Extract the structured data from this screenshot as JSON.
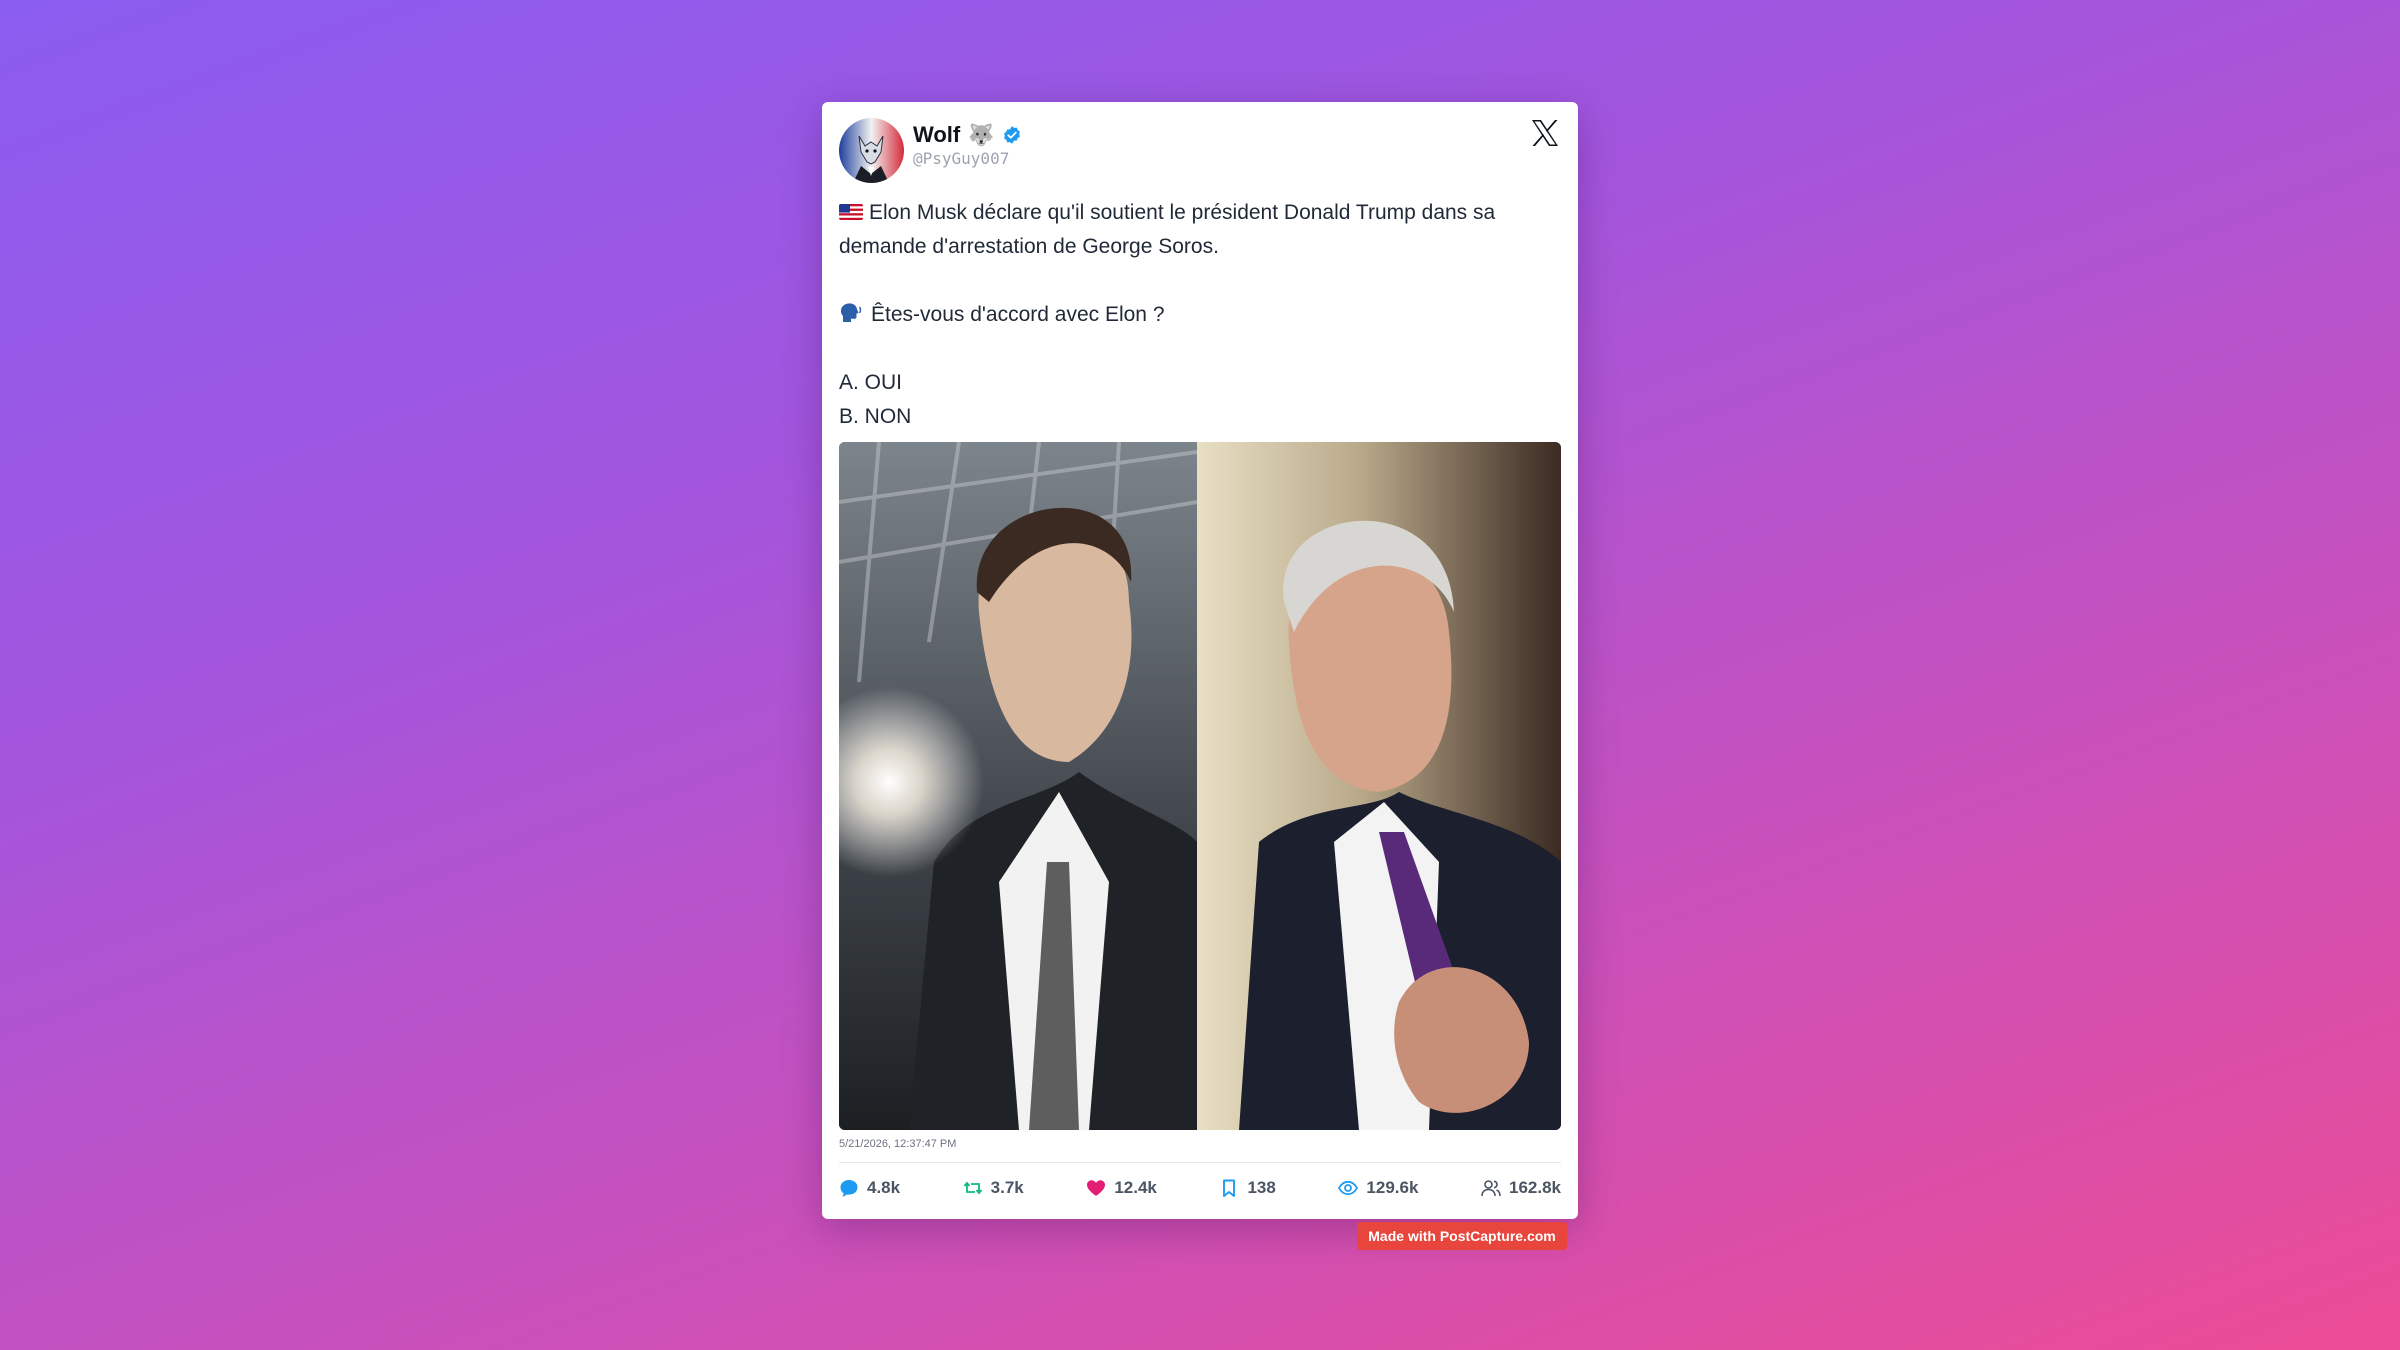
{
  "author": {
    "name": "Wolf",
    "name_emoji": "🐺",
    "handle": "@PsyGuy007",
    "verified": true
  },
  "tweet": {
    "line1": "Elon Musk déclare qu'il soutient le président Donald Trump dans sa demande d'arrestation de George Soros.",
    "line1_icon": "us-flag-icon",
    "line2": "Êtes-vous d'accord avec Elon ?",
    "line2_icon": "speaking-head-icon",
    "option_a": "A. OUI",
    "option_b": "B. NON"
  },
  "timestamp": "5/21/2026, 12:37:47 PM",
  "stats": {
    "replies": "4.8k",
    "retweets": "3.7k",
    "likes": "12.4k",
    "bookmarks": "138",
    "views": "129.6k",
    "followers": "162.8k"
  },
  "colors": {
    "verified": "#1d9bf0",
    "reply": "#1d9bf0",
    "retweet": "#10b981",
    "like": "#e11d74",
    "bookmark": "#1d9bf0",
    "views": "#1d9bf0",
    "badge": "#e8453c"
  },
  "watermark": "Made with PostCapture.com"
}
